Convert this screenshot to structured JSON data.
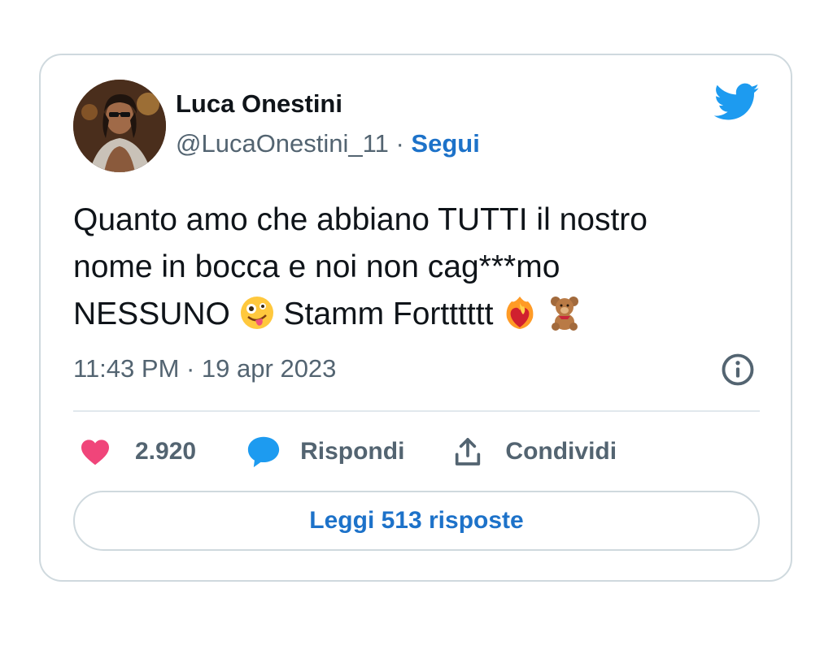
{
  "user": {
    "name": "Luca Onestini",
    "handle": "@LucaOnestini_11",
    "separator": " · ",
    "follow_label": "Segui"
  },
  "tweet": {
    "line1": "Quanto amo che abbiano TUTTI il nostro",
    "line2": "nome in bocca e noi non cag***mo",
    "line3_a": "NESSUNO ",
    "line3_b": " Stamm Fortttttt ",
    "timestamp": "11:43 PM · 19 apr 2023"
  },
  "actions": {
    "likes": "2.920",
    "reply_label": "Rispondi",
    "share_label": "Condividi"
  },
  "read_replies_label": "Leggi 513 risposte",
  "colors": {
    "accent": "#1d72c9",
    "twitter_blue": "#1d9bf0",
    "like_pink": "#f0457a",
    "text_primary": "#0f1419",
    "text_secondary": "#536471",
    "border": "#cfd9de"
  },
  "icons": [
    "twitter-bird-icon",
    "info-icon",
    "heart-icon",
    "speech-bubble-icon",
    "share-icon",
    "zany-face-emoji",
    "heart-on-fire-emoji",
    "teddy-bear-emoji"
  ]
}
